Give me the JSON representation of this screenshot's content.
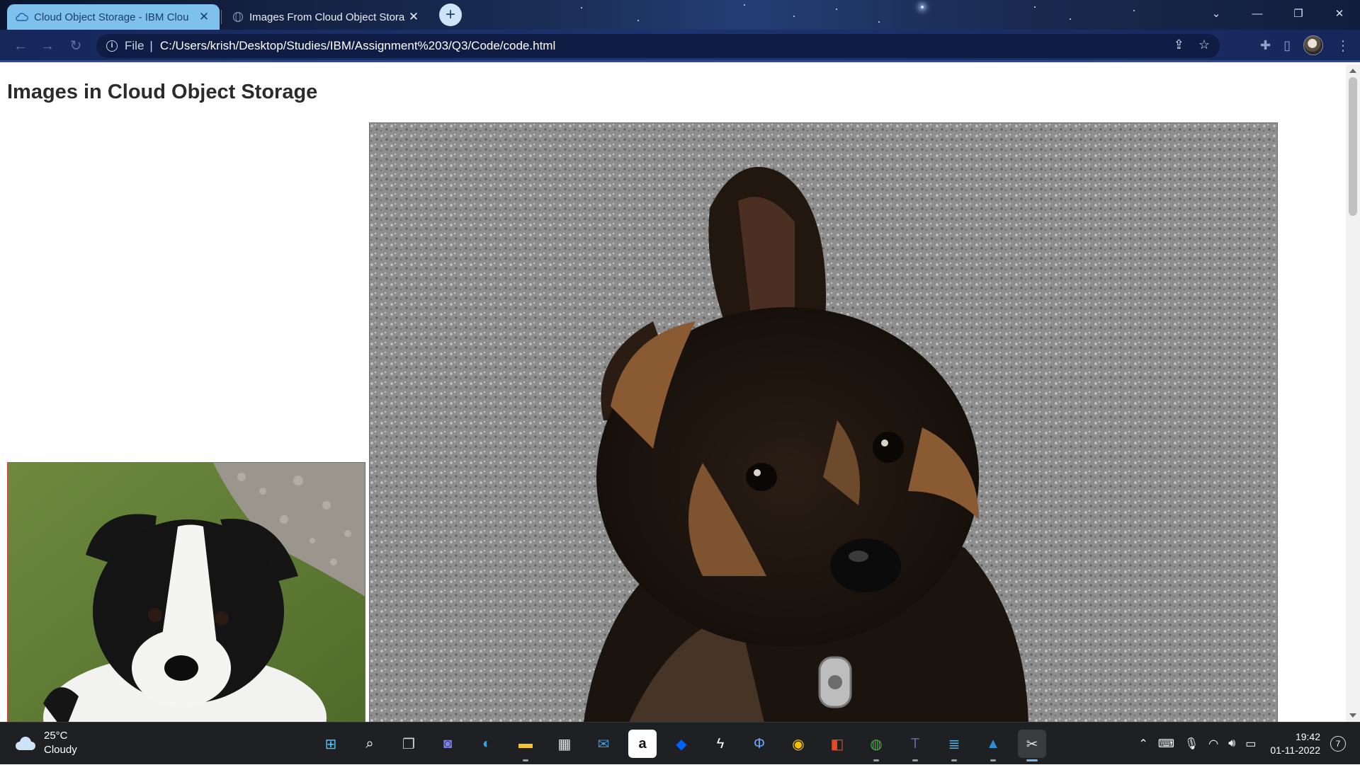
{
  "browser": {
    "tabs": [
      {
        "title": "Cloud Object Storage - IBM Clou",
        "active": true,
        "favicon": "cloud-icon"
      },
      {
        "title": "Images From Cloud Object Stora",
        "active": false,
        "favicon": "globe-icon"
      }
    ],
    "new_tab_label": "+",
    "address": {
      "scheme": "File",
      "separator": "|",
      "url": "C:/Users/krish/Desktop/Studies/IBM/Assignment%203/Q3/Code/code.html"
    },
    "window_controls": [
      "chevron-down-icon",
      "minimize-icon",
      "restore-icon",
      "close-icon"
    ],
    "colors": {
      "active_tab": "#7ec1ec",
      "toolbar": "#1d3370",
      "omnibox": "#0f1c44"
    }
  },
  "page": {
    "title": "Images in Cloud Object Storage",
    "images": [
      {
        "subject": "black and white border collie puppy on grass",
        "border_color": "#cc4444"
      },
      {
        "subject": "german shepherd puppy on asphalt",
        "border_color": "#cc4444"
      }
    ]
  },
  "taskbar": {
    "weather": {
      "temp": "25°C",
      "condition": "Cloudy",
      "icon": "cloud-icon"
    },
    "apps": [
      {
        "name": "start-icon",
        "glyph": "⊞",
        "color": "#4cc2ff"
      },
      {
        "name": "search-icon",
        "glyph": "⌕",
        "color": "#ffffff"
      },
      {
        "name": "task-view-icon",
        "glyph": "❐",
        "color": "#cfd3da"
      },
      {
        "name": "teams-chat-icon",
        "glyph": "◙",
        "color": "#7b83eb"
      },
      {
        "name": "edge-icon",
        "glyph": "◐",
        "color": "#2ea7e0"
      },
      {
        "name": "file-explorer-icon",
        "glyph": "▬",
        "color": "#f4c430"
      },
      {
        "name": "store-icon",
        "glyph": "▦",
        "color": "#e8e8e8"
      },
      {
        "name": "mail-icon",
        "glyph": "✉",
        "color": "#3b9ee8"
      },
      {
        "name": "amazon-icon",
        "glyph": "a",
        "color": "#111111"
      },
      {
        "name": "dropbox-icon",
        "glyph": "◆",
        "color": "#0061ff"
      },
      {
        "name": "bolt-app-icon",
        "glyph": "ϟ",
        "color": "#ffffff"
      },
      {
        "name": "phone-link-icon",
        "glyph": "Φ",
        "color": "#6aa7ff"
      },
      {
        "name": "norton-icon",
        "glyph": "◉",
        "color": "#f2c200"
      },
      {
        "name": "office-icon",
        "glyph": "◧",
        "color": "#e24a25"
      },
      {
        "name": "chrome-icon",
        "glyph": "◍",
        "color": "#4caf50"
      },
      {
        "name": "teams-icon",
        "glyph": "T",
        "color": "#6264a7"
      },
      {
        "name": "notepad-icon",
        "glyph": "≣",
        "color": "#4fb7e8"
      },
      {
        "name": "photos-icon",
        "glyph": "▲",
        "color": "#2b8fd6"
      },
      {
        "name": "snipping-tool-icon",
        "glyph": "✂",
        "color": "#e5e5e5"
      }
    ],
    "tray": {
      "icons": [
        "chevron-up-icon",
        "keyboard-icon",
        "mic-muted-icon",
        "wifi-icon",
        "volume-icon",
        "battery-icon"
      ],
      "time": "19:42",
      "date": "01-11-2022",
      "notifications": "7"
    }
  }
}
